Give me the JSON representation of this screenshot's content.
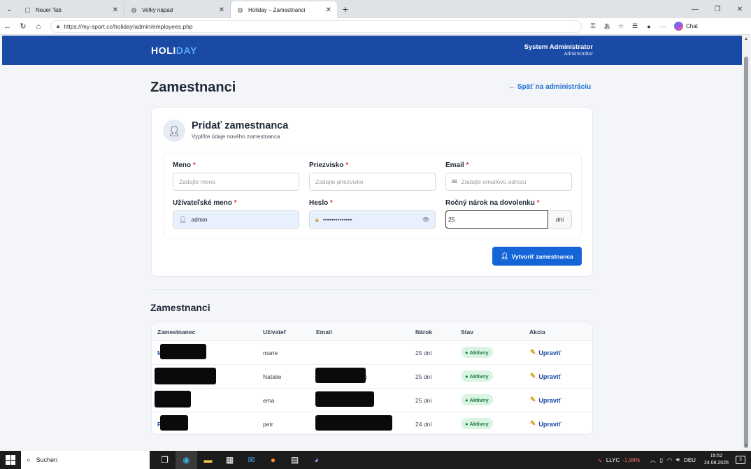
{
  "browser": {
    "tabs": [
      {
        "title": "Neuer Tab",
        "icon": "page-icon",
        "active": false
      },
      {
        "title": "Veľký nápad",
        "icon": "globe-icon",
        "active": false
      },
      {
        "title": "Holiday – Zamestnanci",
        "icon": "globe-icon",
        "active": true
      }
    ],
    "url": "https://my-sport.cc/holiday/admin/employees.php",
    "chat_label": "Chat"
  },
  "header": {
    "logo_part1": "HOLI",
    "logo_part2": "DAY",
    "user_name": "System Administrator",
    "user_role": "Administrátor"
  },
  "page": {
    "title": "Zamestnanci",
    "back_link": "← Späť na administráciu"
  },
  "form": {
    "title": "Pridať zamestnanca",
    "subtitle": "Vyplňte údaje nového zamestnanca",
    "required_mark": "*",
    "fields": {
      "first_name": {
        "label": "Meno",
        "placeholder": "Zadajte meno",
        "value": ""
      },
      "last_name": {
        "label": "Priezvisko",
        "placeholder": "Zadajte priezvisko",
        "value": ""
      },
      "email": {
        "label": "Email",
        "placeholder": "Zadajte emailovú adresu",
        "value": ""
      },
      "username": {
        "label": "Užívateľské meno",
        "value": "admin"
      },
      "password": {
        "label": "Heslo",
        "value": "••••••••••••••"
      },
      "vacation": {
        "label": "Ročný nárok na dovolenku",
        "value": "25",
        "unit": "dní"
      }
    },
    "submit_label": "Vytvoriť zamestnanca"
  },
  "employees": {
    "title": "Zamestnanci",
    "columns": [
      "Zamestnanec",
      "Užívateľ",
      "Email",
      "Nárok",
      "Stav",
      "Akcia"
    ],
    "rows": [
      {
        "name": "M",
        "username": "marie",
        "email": "",
        "allowance": "25 dní",
        "status": "Aktívny",
        "action": "Upraviť"
      },
      {
        "name": "",
        "username": "Natalie",
        "email": "c",
        "allowance": "25 dní",
        "status": "Aktívny",
        "action": "Upraviť"
      },
      {
        "name": "",
        "username": "ema",
        "email": "",
        "allowance": "25 dní",
        "status": "Aktívny",
        "action": "Upraviť"
      },
      {
        "name": "P",
        "username": "petr",
        "email": "",
        "allowance": "24 dní",
        "status": "Aktívny",
        "action": "Upraviť"
      }
    ]
  },
  "taskbar": {
    "search_label": "Suchen",
    "stock_name": "LLYC",
    "stock_change": "-1,99%",
    "lang": "DEU",
    "time": "15:52",
    "date": "24.08.2026",
    "notif_count": "3"
  },
  "colors": {
    "header_bg": "#1a4aa6",
    "accent": "#1565d8",
    "status_active": "#167a3e"
  }
}
